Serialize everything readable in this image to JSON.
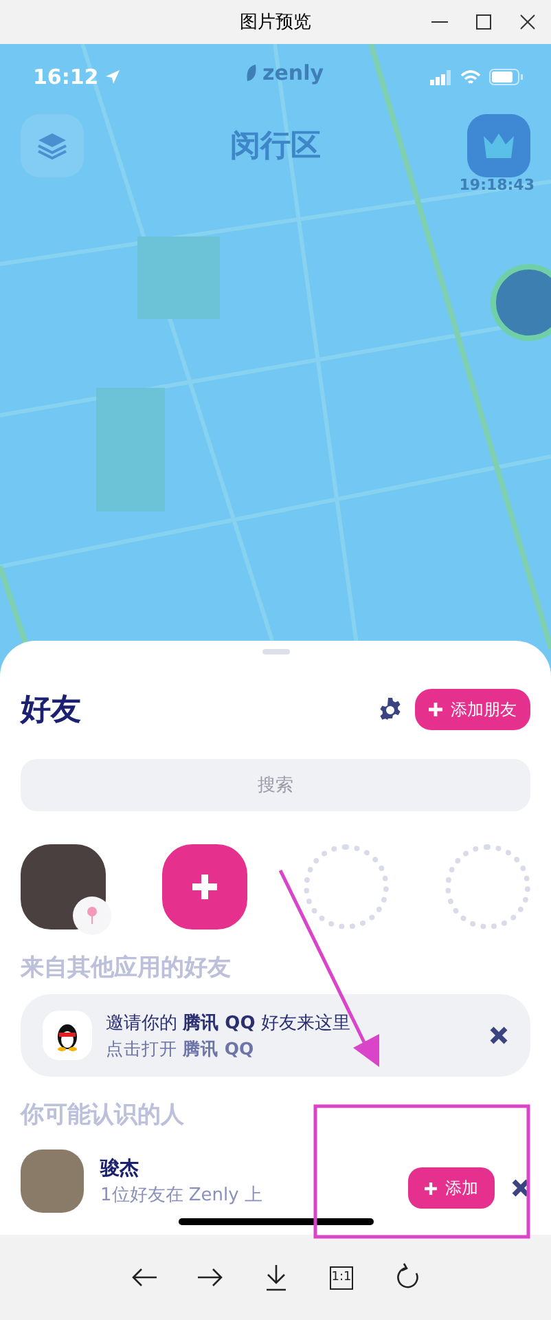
{
  "window": {
    "title": "图片预览"
  },
  "status_bar": {
    "time": "16:12",
    "logo": "zenly"
  },
  "map": {
    "district": "闵行区",
    "clock": "19:18:43"
  },
  "sheet": {
    "title": "好友",
    "add_button": "添加朋友",
    "search": {
      "placeholder": "搜索"
    },
    "friends": [
      {
        "kind": "avatar"
      },
      {
        "kind": "add"
      },
      {
        "kind": "empty"
      },
      {
        "kind": "empty"
      }
    ],
    "other_apps": {
      "heading": "来自其他应用的好友",
      "invite": {
        "title": "邀请你的 **腾讯 QQ** 好友来这里",
        "subtitle": "点击打开 **腾讯 QQ**"
      }
    },
    "suggestions": {
      "heading": "你可能认识的人",
      "people": [
        {
          "name": "骏杰",
          "subtitle": "1位好友在 Zenly 上",
          "button": "添加"
        }
      ]
    }
  },
  "toolbar": [
    {
      "kind": "back"
    },
    {
      "kind": "forward"
    },
    {
      "kind": "download"
    },
    {
      "kind": "actual-size",
      "label": "1:1"
    },
    {
      "kind": "rotate"
    }
  ]
}
